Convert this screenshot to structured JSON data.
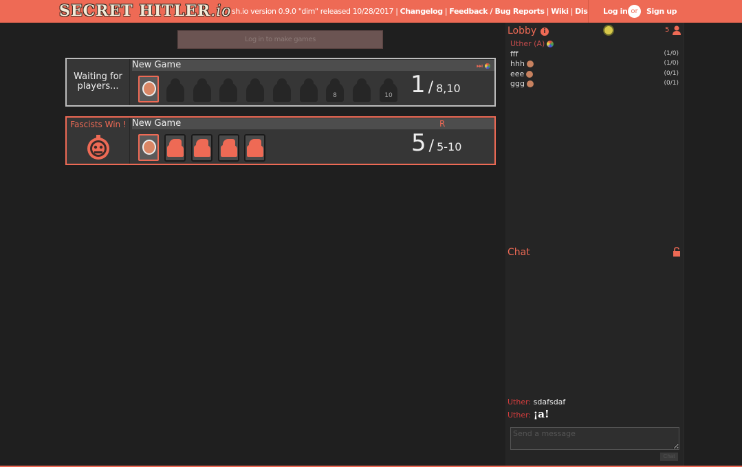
{
  "header": {
    "logo_text": "SECRET HITLER",
    "logo_io": ".io",
    "version_text": "sh.io version 0.9.0 \"dim\" released 10/28/2017 |",
    "changelog": "Changelog",
    "feedback": "Feedback / Bug Reports",
    "wiki": "Wiki",
    "discord": "Discord",
    "sep": "|",
    "login": "Log in",
    "or": "or",
    "signup": "Sign up"
  },
  "make_games_label": "Log in to make games",
  "games": [
    {
      "status": "Waiting for players...",
      "title": "New Game",
      "flags": "⏭",
      "player_count": "1",
      "slash": "/",
      "size": "8,10",
      "ghost_labels": [
        "",
        "",
        "",
        "",
        "",
        "",
        "8",
        "",
        "10"
      ]
    },
    {
      "status": "Fascists Win !",
      "title": "New Game",
      "flag": "R",
      "player_count": "5",
      "slash": "/",
      "size": "5-10"
    }
  ],
  "lobby": {
    "title": "Lobby",
    "user_count": "5",
    "users": [
      {
        "name": "Uther (A)",
        "stats": "",
        "admin": true
      },
      {
        "name": "fff",
        "stats": "(1/0)"
      },
      {
        "name": "hhh",
        "stats": "(1/0)"
      },
      {
        "name": "eee",
        "stats": "(0/1)"
      },
      {
        "name": "ggg",
        "stats": "(0/1)"
      }
    ]
  },
  "chat": {
    "title": "Chat",
    "messages": [
      {
        "user": "Uther:",
        "text": "sdafsdaf"
      },
      {
        "user": "Uther:",
        "text": "¡a!"
      }
    ],
    "input_placeholder": "Send a message",
    "send_label": "Chat"
  },
  "colors": {
    "accent": "#ee6a55",
    "background": "#1f1f1f",
    "panel": "#363636"
  }
}
